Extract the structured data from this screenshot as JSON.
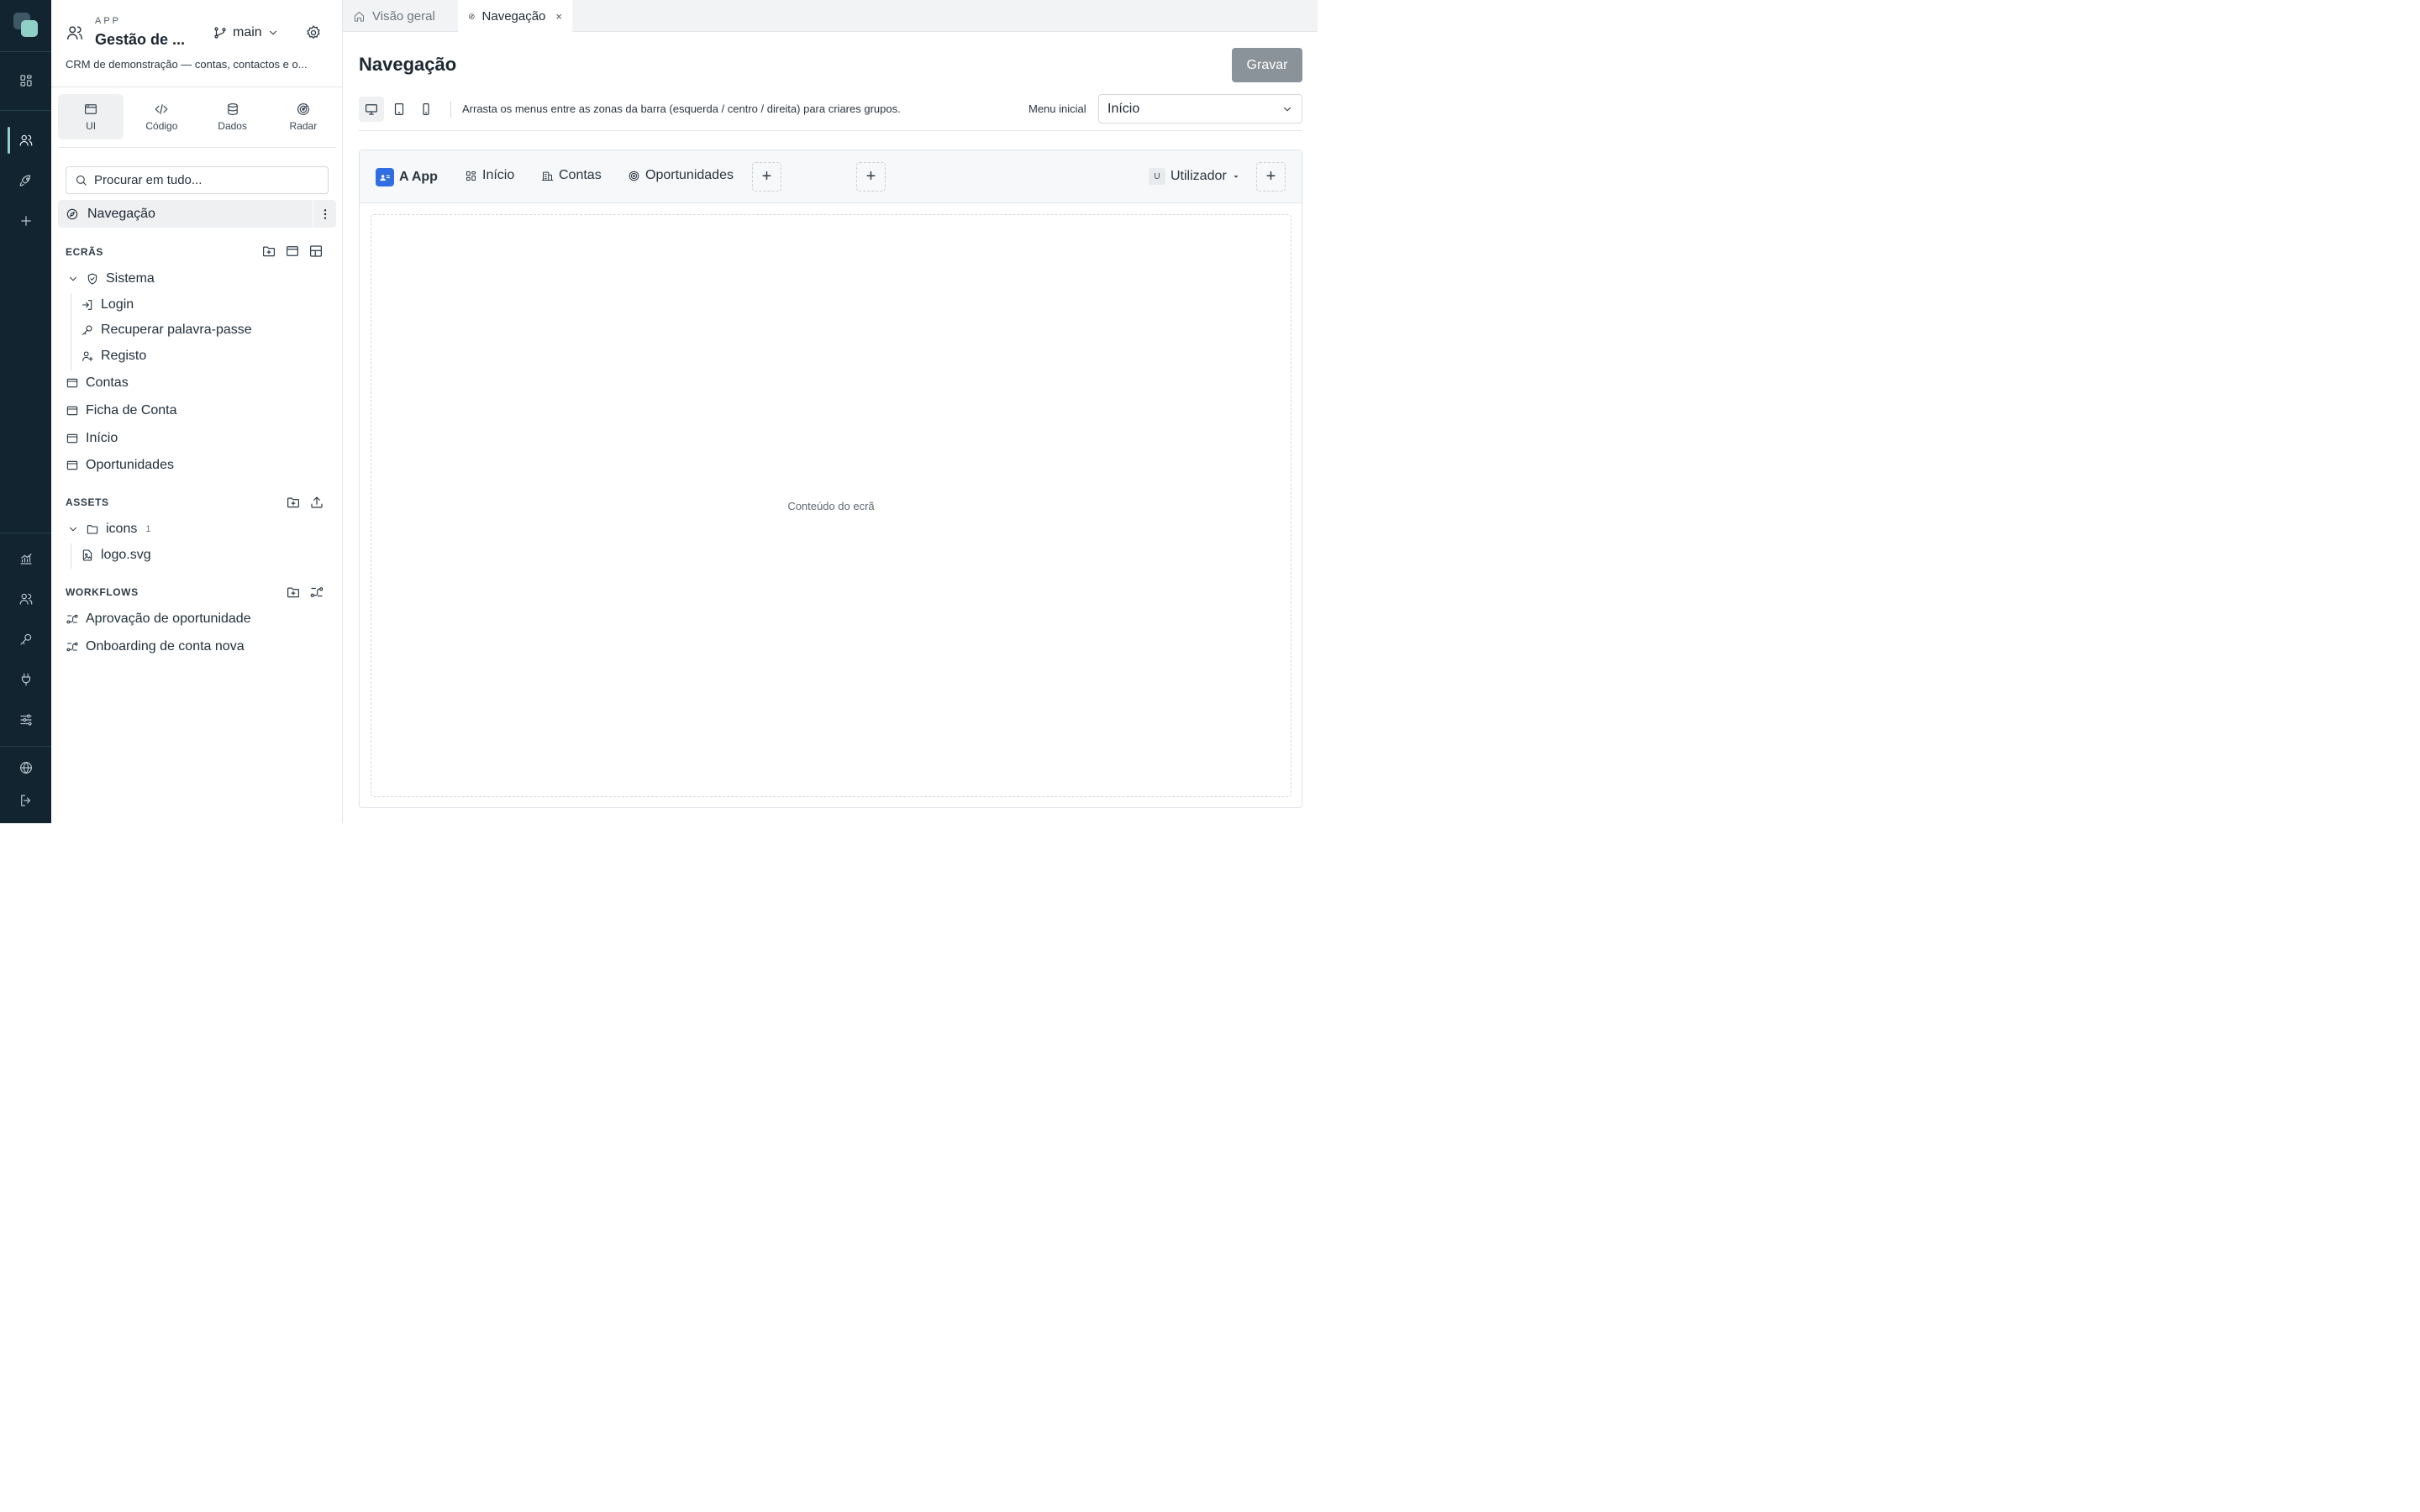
{
  "app": {
    "kicker": "APP",
    "name": "Gestão de ...",
    "branch": "main",
    "description": "CRM de demonstração — contas, contactos e o..."
  },
  "section_tabs": [
    {
      "label": "UI",
      "icon": "window-icon",
      "active": true
    },
    {
      "label": "Código",
      "icon": "code-icon",
      "active": false
    },
    {
      "label": "Dados",
      "icon": "database-icon",
      "active": false
    },
    {
      "label": "Radar",
      "icon": "radar-icon",
      "active": false
    }
  ],
  "search": {
    "placeholder": "Procurar em tudo..."
  },
  "navigation_item": {
    "label": "Navegação"
  },
  "screens": {
    "title": "ECRÃS",
    "group": {
      "label": "Sistema",
      "children": [
        "Login",
        "Recuperar palavra-passe",
        "Registo"
      ]
    },
    "items": [
      "Contas",
      "Ficha de Conta",
      "Início",
      "Oportunidades"
    ]
  },
  "assets": {
    "title": "ASSETS",
    "folder": {
      "label": "icons",
      "count": "1"
    },
    "files": [
      "logo.svg"
    ]
  },
  "workflows": {
    "title": "WORKFLOWS",
    "items": [
      "Aprovação de oportunidade",
      "Onboarding de conta nova"
    ]
  },
  "doc_tabs": [
    {
      "label": "Visão geral",
      "active": false
    },
    {
      "label": "Navegação",
      "active": true,
      "close": "×"
    }
  ],
  "page": {
    "title": "Navegação",
    "save_label": "Gravar",
    "hint": "Arrasta os menus entre as zonas da barra (esquerda / centro / direita) para criares grupos.",
    "initial_menu_label": "Menu inicial",
    "initial_menu_value": "Início"
  },
  "menubar": {
    "brand": "A App",
    "items": [
      "Início",
      "Contas",
      "Oportunidades"
    ],
    "user_initial": "U",
    "user_label": "Utilizador",
    "add": "+"
  },
  "canvas_placeholder": "Conteúdo do ecrã",
  "colors": {
    "rail_bg": "#122430",
    "accent": "#8fd1c6",
    "brand_blue": "#2f6de1",
    "save_bg": "#8a9399"
  }
}
